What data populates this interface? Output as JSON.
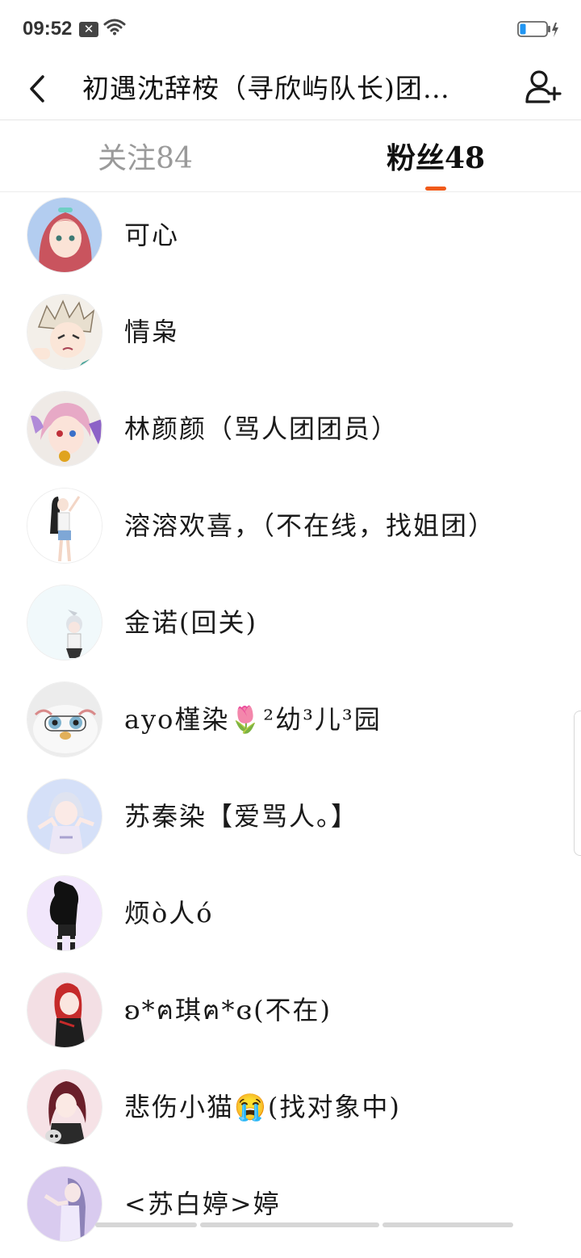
{
  "status_bar": {
    "time": "09:52",
    "notification_badge": "✕"
  },
  "header": {
    "title": "初遇沈辞桉（寻欣屿队长)团…",
    "back_icon": "chevron-left-icon",
    "add_icon": "add-user-icon"
  },
  "tabs": [
    {
      "label": "关注84",
      "active": false
    },
    {
      "label": "粉丝48",
      "active": true
    }
  ],
  "accent_color": "#f05a1a",
  "followers": [
    {
      "name": "可心"
    },
    {
      "name": "情枭"
    },
    {
      "name": "林颜颜（骂人团团员）"
    },
    {
      "name": "溶溶欢喜，（不在线，找姐团）"
    },
    {
      "name": "金诺(回关)"
    },
    {
      "name": "ayo槿染🌷²幼³儿³园"
    },
    {
      "name": "苏秦染【爱骂人。】"
    },
    {
      "name": "烦ò人ó"
    },
    {
      "name": "ʚ*ฅ琪ฅ*ɞ(不在)"
    },
    {
      "name": "悲伤小猫😭(找对象中)"
    },
    {
      "name": "<苏白婷>婷"
    }
  ]
}
